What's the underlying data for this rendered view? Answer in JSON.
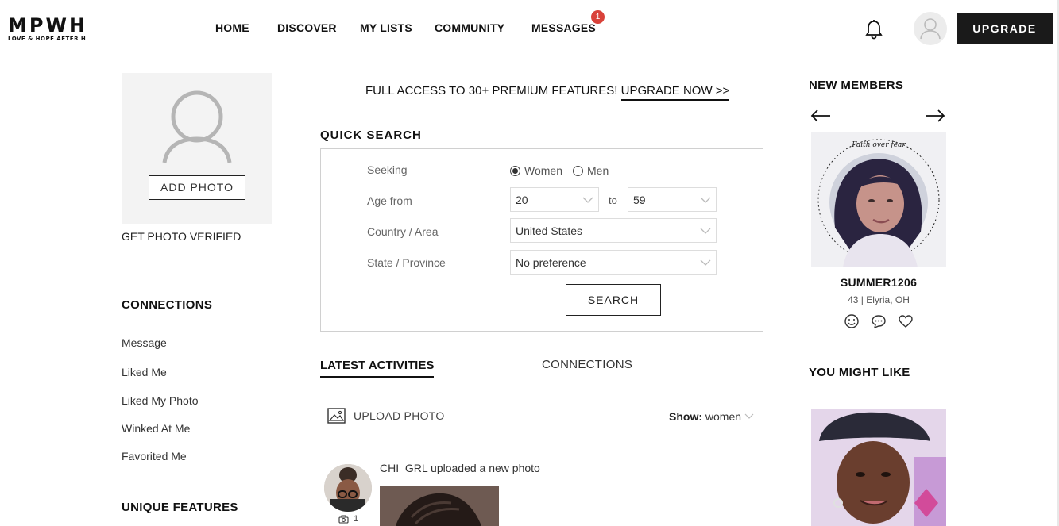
{
  "header": {
    "logo_main": "MPWH",
    "logo_sub": "LOVE & HOPE AFTER H",
    "nav": [
      {
        "label": "HOME"
      },
      {
        "label": "DISCOVER"
      },
      {
        "label": "MY LISTS"
      },
      {
        "label": "COMMUNITY"
      },
      {
        "label": "MESSAGES",
        "badge": "1"
      }
    ],
    "upgrade_label": "UPGRADE",
    "icons": [
      "bell-icon",
      "user-avatar-icon"
    ]
  },
  "left": {
    "add_photo_label": "ADD PHOTO",
    "verify_label": "GET PHOTO VERIFIED",
    "connections_heading": "CONNECTIONS",
    "connections": [
      "Message",
      "Liked Me",
      "Liked My Photo",
      "Winked At Me",
      "Favorited Me"
    ],
    "unique_heading": "UNIQUE FEATURES"
  },
  "promo": {
    "text": "FULL ACCESS TO 30+ PREMIUM FEATURES!",
    "link": "UPGRADE NOW >>"
  },
  "quick_search": {
    "heading": "QUICK SEARCH",
    "seeking_label": "Seeking",
    "options": [
      "Women",
      "Men"
    ],
    "selected_option": "Women",
    "age_label": "Age from",
    "age_from": "20",
    "age_to_label": "to",
    "age_to": "59",
    "country_label": "Country / Area",
    "country_value": "United States",
    "state_label": "State / Province",
    "state_value": "No preference",
    "search_label": "SEARCH"
  },
  "activities": {
    "tab_active": "LATEST ACTIVITIES",
    "tab_inactive": "CONNECTIONS",
    "upload_label": "UPLOAD PHOTO",
    "show_label": "Show:",
    "show_value": "women",
    "item_text": "CHI_GRL uploaded a new photo",
    "item_photo_count": "1"
  },
  "right": {
    "new_members_heading": "NEW MEMBERS",
    "member_name": "SUMMER1206",
    "member_meta": "43 | Elyria, OH",
    "member_photo_text": "Faith over fear",
    "you_might_like_heading": "YOU MIGHT LIKE"
  },
  "colors": {
    "brand_dark": "#1a1a1a",
    "badge_red": "#d9423a",
    "border_grey": "#d0d0d0"
  }
}
